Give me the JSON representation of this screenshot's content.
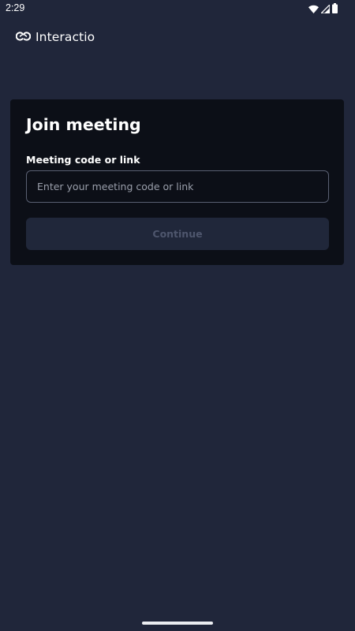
{
  "status_bar": {
    "time": "2:29",
    "icons": [
      "wifi-icon",
      "signal-icon",
      "battery-icon"
    ]
  },
  "app_bar": {
    "logo_icon": "interactio-logo-icon",
    "brand_name": "Interactio"
  },
  "join_card": {
    "title": "Join meeting",
    "field_label": "Meeting code or link",
    "input_value": "",
    "input_placeholder": "Enter your meeting code or link",
    "continue_label": "Continue",
    "continue_enabled": false
  },
  "colors": {
    "background": "#20263a",
    "card_background": "#0c0f17",
    "input_border": "#5a6072",
    "button_background_disabled": "#20273a",
    "button_text_disabled": "#4e566d",
    "text_primary": "#ffffff",
    "placeholder": "#9a9fab"
  }
}
